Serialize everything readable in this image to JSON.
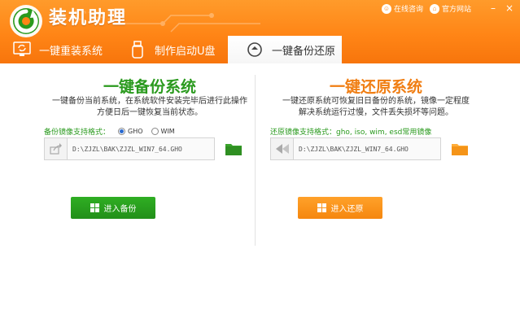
{
  "app": {
    "title": "装机助理",
    "title_reflection": "装机助理"
  },
  "top_links": {
    "online_consult": "在线咨询",
    "official_site": "官方网站"
  },
  "window_controls": {
    "minimize": "–",
    "close": "×"
  },
  "tabs": [
    {
      "label": "一键重装系统",
      "icon": "monitor-refresh-icon",
      "active": false
    },
    {
      "label": "制作启动U盘",
      "icon": "usb-drive-icon",
      "active": false
    },
    {
      "label": "一键备份还原",
      "icon": "backup-circle-icon",
      "active": true
    }
  ],
  "backup_panel": {
    "title": "一键备份系统",
    "description_line1": "一键备份当前系统，在系统软件安装完毕后进行此操作",
    "description_line2": "方便日后一键恢复当前状态。",
    "format_label": "备份镜像支持格式：",
    "format_options": [
      "GHO",
      "WIM"
    ],
    "selected_format": "GHO",
    "path": "D:\\ZJZL\\BAK\\ZJZL_WIN7_64.GHO",
    "button_label": "进入备份"
  },
  "restore_panel": {
    "title": "一键还原系统",
    "description_line1": "一键还原系统可恢复旧日备份的系统，镜像一定程度",
    "description_line2": "解决系统运行过慢，文件丢失损坏等问题。",
    "format_label": "还原镜像支持格式：gho, iso, wim, esd常用镜像",
    "path": "D:\\ZJZL\\BAK\\ZJZL_WIN7_64.GHO",
    "button_label": "进入还原"
  },
  "colors": {
    "header_orange": "#ff8516",
    "backup_green": "#2a9a1e",
    "restore_orange": "#f07e13"
  }
}
